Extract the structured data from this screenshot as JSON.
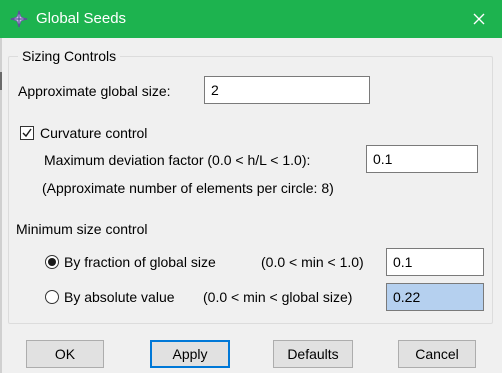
{
  "window": {
    "title": "Global Seeds",
    "icon": "abaqus-cross-icon",
    "close_icon": "close-icon",
    "titlebar_color": "#1db34f"
  },
  "sizing": {
    "group_title": "Sizing Controls",
    "global_size_label": "Approximate global size:",
    "global_size_value": "2",
    "curvature_label": "Curvature control",
    "curvature_checked": true,
    "deviation_label": "Maximum deviation factor (0.0 < h/L < 1.0):",
    "deviation_value": "0.1",
    "elements_note": "(Approximate number of elements per circle: 8)"
  },
  "min_size": {
    "label": "Minimum size control",
    "fraction_label": "By fraction of global size",
    "fraction_range": "(0.0 < min < 1.0)",
    "fraction_value": "0.1",
    "fraction_selected": true,
    "absolute_label": "By absolute value",
    "absolute_range": "(0.0 < min < global size)",
    "absolute_value": "0.22",
    "absolute_selected": false,
    "selection_color": "#b5d0ef"
  },
  "buttons": {
    "ok": "OK",
    "apply": "Apply",
    "defaults": "Defaults",
    "cancel": "Cancel",
    "default_border_color": "#0078d7"
  }
}
